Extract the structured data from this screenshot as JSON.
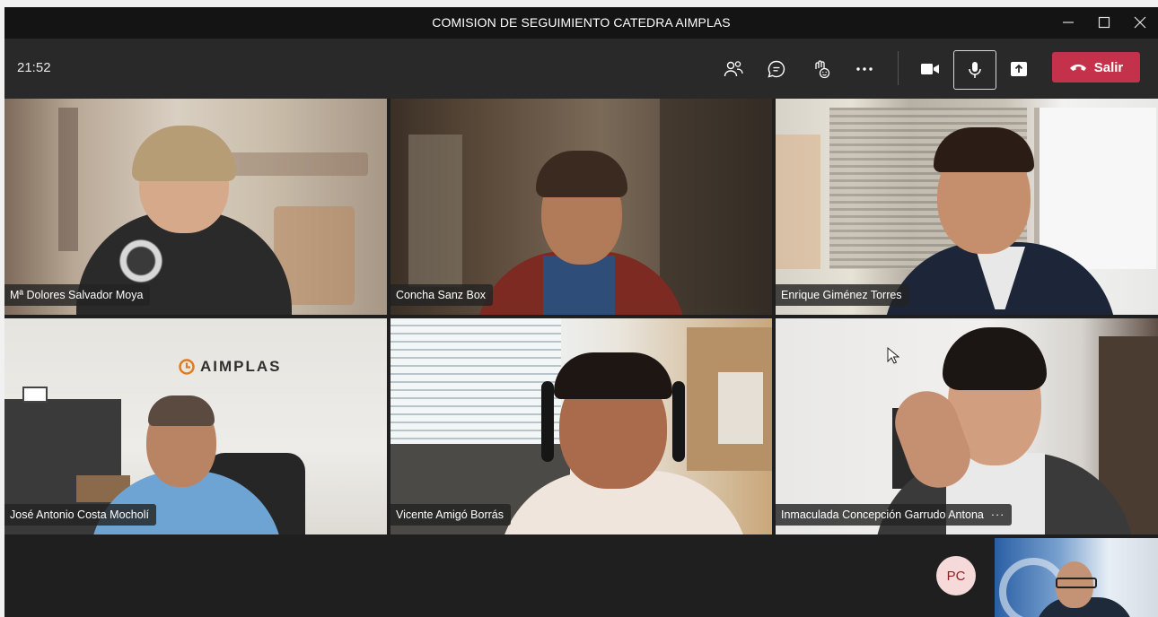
{
  "window": {
    "title": "COMISION DE SEGUIMIENTO CATEDRA AIMPLAS",
    "controls": [
      "minimize-icon",
      "maximize-icon",
      "close-icon"
    ]
  },
  "toolbar": {
    "time": "21:52",
    "buttons": [
      "participants-icon",
      "chat-icon",
      "reactions-icon",
      "more-options-icon",
      "camera-icon",
      "microphone-icon",
      "share-screen-icon"
    ],
    "leave_label": "Salir",
    "leave_color": "#c4314b"
  },
  "participants": [
    {
      "name": "Mª Dolores Salvador Moya"
    },
    {
      "name": "Concha Sanz Box"
    },
    {
      "name": "Enrique Giménez Torres"
    },
    {
      "name": "José Antonio Costa Mocholí"
    },
    {
      "name": "Vicente Amigó Borrás"
    },
    {
      "name": "Inmaculada Concepción Garrudo Antona",
      "more": "···"
    }
  ],
  "backgrounds": {
    "logo_text": "AIMPLAS"
  },
  "bottom_bar": {
    "avatar_initials": "PC",
    "avatar_bg": "#f6d9d9"
  }
}
